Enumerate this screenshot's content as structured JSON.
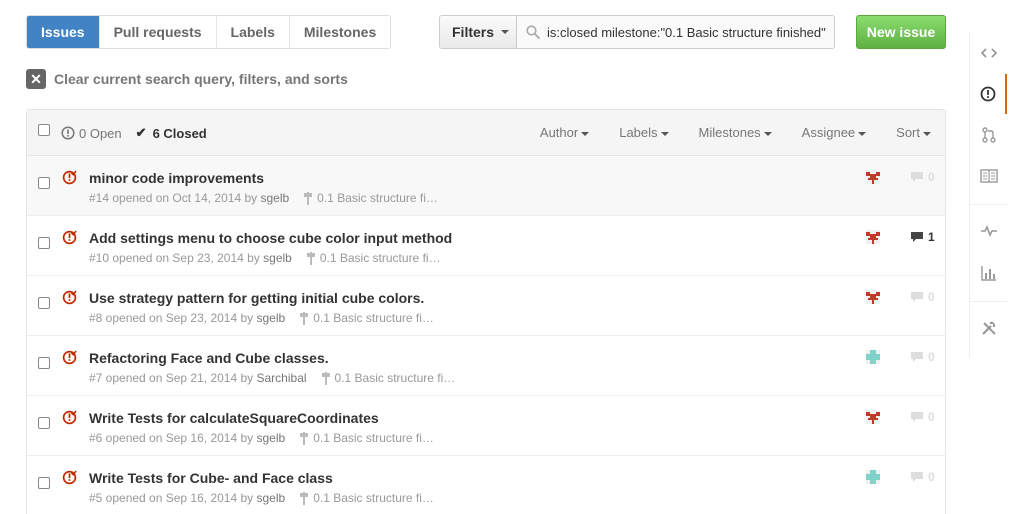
{
  "nav": {
    "tabs": [
      {
        "label": "Issues",
        "selected": true
      },
      {
        "label": "Pull requests",
        "selected": false
      },
      {
        "label": "Labels",
        "selected": false
      },
      {
        "label": "Milestones",
        "selected": false
      }
    ]
  },
  "search": {
    "filters_label": "Filters",
    "query": "is:closed milestone:\"0.1 Basic structure finished\""
  },
  "new_issue_label": "New issue",
  "clear_query_label": "Clear current search query, filters, and sorts",
  "table_header": {
    "open_label": "0 Open",
    "closed_label": "6 Closed",
    "filters": [
      "Author",
      "Labels",
      "Milestones",
      "Assignee",
      "Sort"
    ]
  },
  "issues": [
    {
      "title": "minor code improvements",
      "meta_prefix": "#14 opened on Oct 14, 2014 by",
      "author": "sgelb",
      "milestone": "0.1 Basic structure fi…",
      "comments": "0",
      "avatar": "red"
    },
    {
      "title": "Add settings menu to choose cube color input method",
      "meta_prefix": "#10 opened on Sep 23, 2014 by",
      "author": "sgelb",
      "milestone": "0.1 Basic structure fi…",
      "comments": "1",
      "avatar": "red"
    },
    {
      "title": "Use strategy pattern for getting initial cube colors.",
      "meta_prefix": "#8 opened on Sep 23, 2014 by",
      "author": "sgelb",
      "milestone": "0.1 Basic structure fi…",
      "comments": "0",
      "avatar": "red"
    },
    {
      "title": "Refactoring Face and Cube classes.",
      "meta_prefix": "#7 opened on Sep 21, 2014 by",
      "author": "Sarchibal",
      "milestone": "0.1 Basic structure fi…",
      "comments": "0",
      "avatar": "teal"
    },
    {
      "title": "Write Tests for calculateSquareCoordinates",
      "meta_prefix": "#6 opened on Sep 16, 2014 by",
      "author": "sgelb",
      "milestone": "0.1 Basic structure fi…",
      "comments": "0",
      "avatar": "red"
    },
    {
      "title": "Write Tests for Cube- and Face class",
      "meta_prefix": "#5 opened on Sep 16, 2014 by",
      "author": "sgelb",
      "milestone": "0.1 Basic structure fi…",
      "comments": "0",
      "avatar": "teal"
    }
  ],
  "sidenav_icons": [
    "code-icon",
    "issues-icon",
    "pull-request-icon",
    "wiki-icon",
    "pulse-icon",
    "graphs-icon",
    "settings-icon"
  ],
  "colors": {
    "accent": "#4183c4",
    "new_issue_green": "#60b044",
    "closed_issue_red": "#bd2c00",
    "sidenav_selected": "#d26911",
    "avatar_red": "#c0392b",
    "avatar_teal": "#7fd3c8"
  }
}
